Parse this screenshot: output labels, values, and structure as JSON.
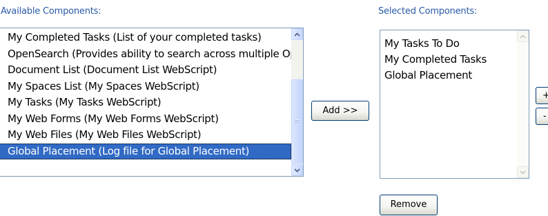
{
  "available": {
    "label": "Available Components:",
    "items": [
      {
        "label": "My Completed Tasks (List of your completed tasks)"
      },
      {
        "label": "OpenSearch (Provides ability to search across multiple Ope"
      },
      {
        "label": "Document List (Document List WebScript)"
      },
      {
        "label": "My Spaces List (My Spaces WebScript)"
      },
      {
        "label": "My Tasks (My Tasks WebScript)"
      },
      {
        "label": "My Web Forms (My Web Forms WebScript)"
      },
      {
        "label": "My Web Files (My Web Files WebScript)"
      },
      {
        "label": "Global Placement (Log file for Global Placement)"
      }
    ],
    "selected_item": "Global Placement (Log file for Global Placement)"
  },
  "selected": {
    "label": "Selected Components:",
    "items": [
      {
        "label": "My Tasks To Do"
      },
      {
        "label": "My Completed Tasks"
      },
      {
        "label": "Global Placement"
      }
    ]
  },
  "buttons": {
    "add": "Add >>",
    "remove": "Remove",
    "move_up": "+",
    "move_down": "-"
  },
  "icons": {
    "scroll_up": "chevron-up-icon",
    "scroll_down": "chevron-down-icon"
  },
  "colors": {
    "label_blue": "#2a5aa8",
    "selection_blue": "#316ac5",
    "list_border": "#7f9db9",
    "button_border": "#003c74"
  }
}
